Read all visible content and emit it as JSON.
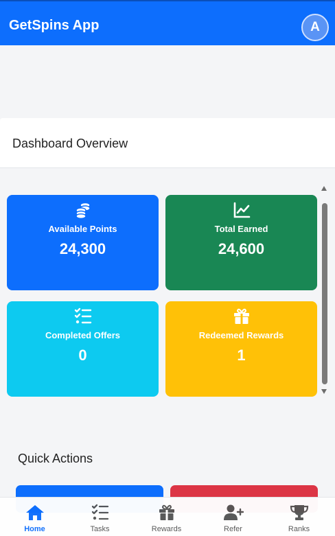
{
  "app": {
    "title": "GetSpins App",
    "avatar_initial": "A"
  },
  "overview": {
    "title": "Dashboard Overview"
  },
  "stats": [
    {
      "label": "Available Points",
      "value": "24,300",
      "icon": "coins-icon",
      "color": "#0d6efd"
    },
    {
      "label": "Total Earned",
      "value": "24,600",
      "icon": "chart-line-icon",
      "color": "#198754"
    },
    {
      "label": "Completed Offers",
      "value": "0",
      "icon": "list-check-icon",
      "color": "#0dcaf0"
    },
    {
      "label": "Redeemed Rewards",
      "value": "1",
      "icon": "gift-icon",
      "color": "#ffc107"
    }
  ],
  "quick_actions": {
    "title": "Quick Actions",
    "buttons": [
      {
        "color": "#0d6efd"
      },
      {
        "color": "#dc3545"
      }
    ]
  },
  "nav": {
    "active": "Home",
    "items": [
      {
        "label": "Home",
        "icon": "home-icon"
      },
      {
        "label": "Tasks",
        "icon": "tasks-icon"
      },
      {
        "label": "Rewards",
        "icon": "gift-icon"
      },
      {
        "label": "Refer",
        "icon": "user-plus-icon"
      },
      {
        "label": "Ranks",
        "icon": "trophy-icon"
      }
    ]
  },
  "colors": {
    "primary": "#0d6efd",
    "nav_inactive": "#555555"
  }
}
